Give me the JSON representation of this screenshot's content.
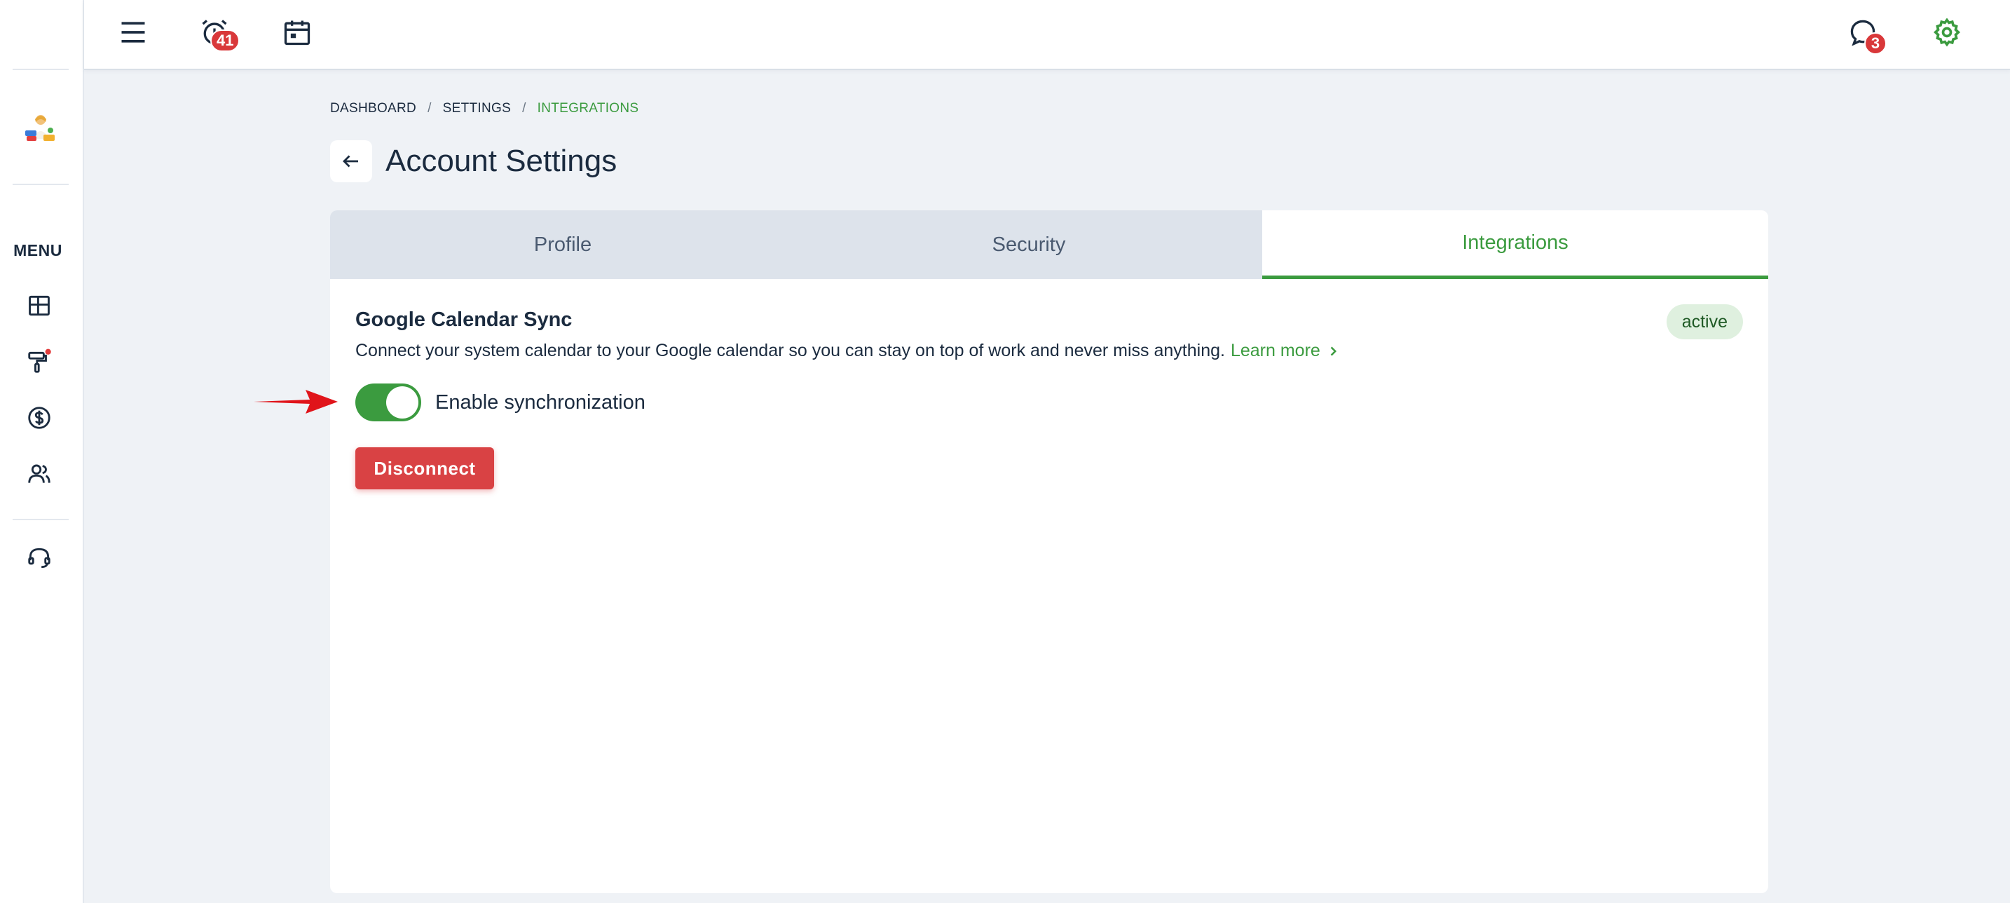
{
  "topbar": {
    "alarm_badge": "41",
    "chat_badge": "3"
  },
  "sidebar": {
    "menu_label": "MENU",
    "icons": [
      "dashboard-icon",
      "paint-roller-icon",
      "dollar-icon",
      "users-icon",
      "headset-icon"
    ]
  },
  "breadcrumb": {
    "items": [
      "DASHBOARD",
      "SETTINGS",
      "INTEGRATIONS"
    ],
    "separator": "/"
  },
  "page": {
    "title": "Account Settings"
  },
  "tabs": [
    {
      "label": "Profile",
      "active": false
    },
    {
      "label": "Security",
      "active": false
    },
    {
      "label": "Integrations",
      "active": true
    }
  ],
  "integration": {
    "title": "Google Calendar Sync",
    "status": "active",
    "description": "Connect your system calendar to your Google calendar so you can stay on top of work and never miss anything.",
    "learn_more": "Learn more",
    "toggle_label": "Enable synchronization",
    "toggle_on": true,
    "disconnect_label": "Disconnect"
  },
  "colors": {
    "accent": "#3b9b3f",
    "danger": "#d94244",
    "badge": "#d9383a",
    "text": "#1b2b3f"
  }
}
